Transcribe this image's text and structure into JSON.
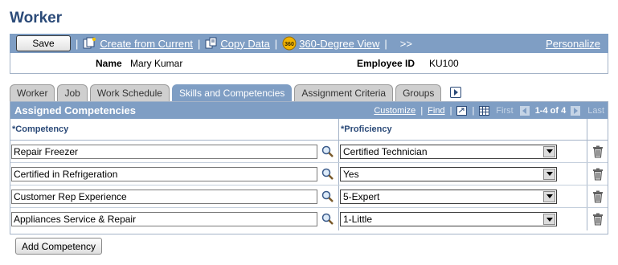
{
  "page": {
    "title": "Worker"
  },
  "toolbar": {
    "save_label": "Save",
    "separator": "|",
    "create_label": "Create from Current",
    "copy_label": "Copy Data",
    "degree_badge": "360",
    "degree_label": "360-Degree View",
    "more_label": ">>",
    "personalize_label": "Personalize"
  },
  "info": {
    "name_label": "Name",
    "name_value": "Mary Kumar",
    "empid_label": "Employee ID",
    "empid_value": "KU100"
  },
  "tabs": [
    {
      "label": "Worker"
    },
    {
      "label": "Job"
    },
    {
      "label": "Work Schedule"
    },
    {
      "label": "Skills and Competencies",
      "active": true
    },
    {
      "label": "Assignment Criteria"
    },
    {
      "label": "Groups"
    }
  ],
  "grid": {
    "title": "Assigned Competencies",
    "customize_label": "Customize",
    "find_label": "Find",
    "sep": "|",
    "first_label": "First",
    "range_label": "1-4 of 4",
    "last_label": "Last",
    "col_competency": "*Competency",
    "col_proficiency": "*Proficiency",
    "rows": [
      {
        "competency": "Repair Freezer",
        "proficiency": "Certified Technician"
      },
      {
        "competency": "Certified in Refrigeration",
        "proficiency": "Yes"
      },
      {
        "competency": "Customer Rep Experience",
        "proficiency": "5-Expert"
      },
      {
        "competency": "Appliances Service & Repair",
        "proficiency": "1-Little"
      }
    ]
  },
  "add_button_label": "Add Competency",
  "colors": {
    "header_blue": "#7f9ec4",
    "title_blue": "#2b4a78",
    "border": "#a4b3c7"
  },
  "icons": {
    "create": "create-from-current-icon",
    "copy": "copy-data-icon",
    "degree": "360-degree-icon",
    "lookup": "magnifier-icon",
    "delete": "trash-icon",
    "tab_next": "tab-next-icon"
  }
}
